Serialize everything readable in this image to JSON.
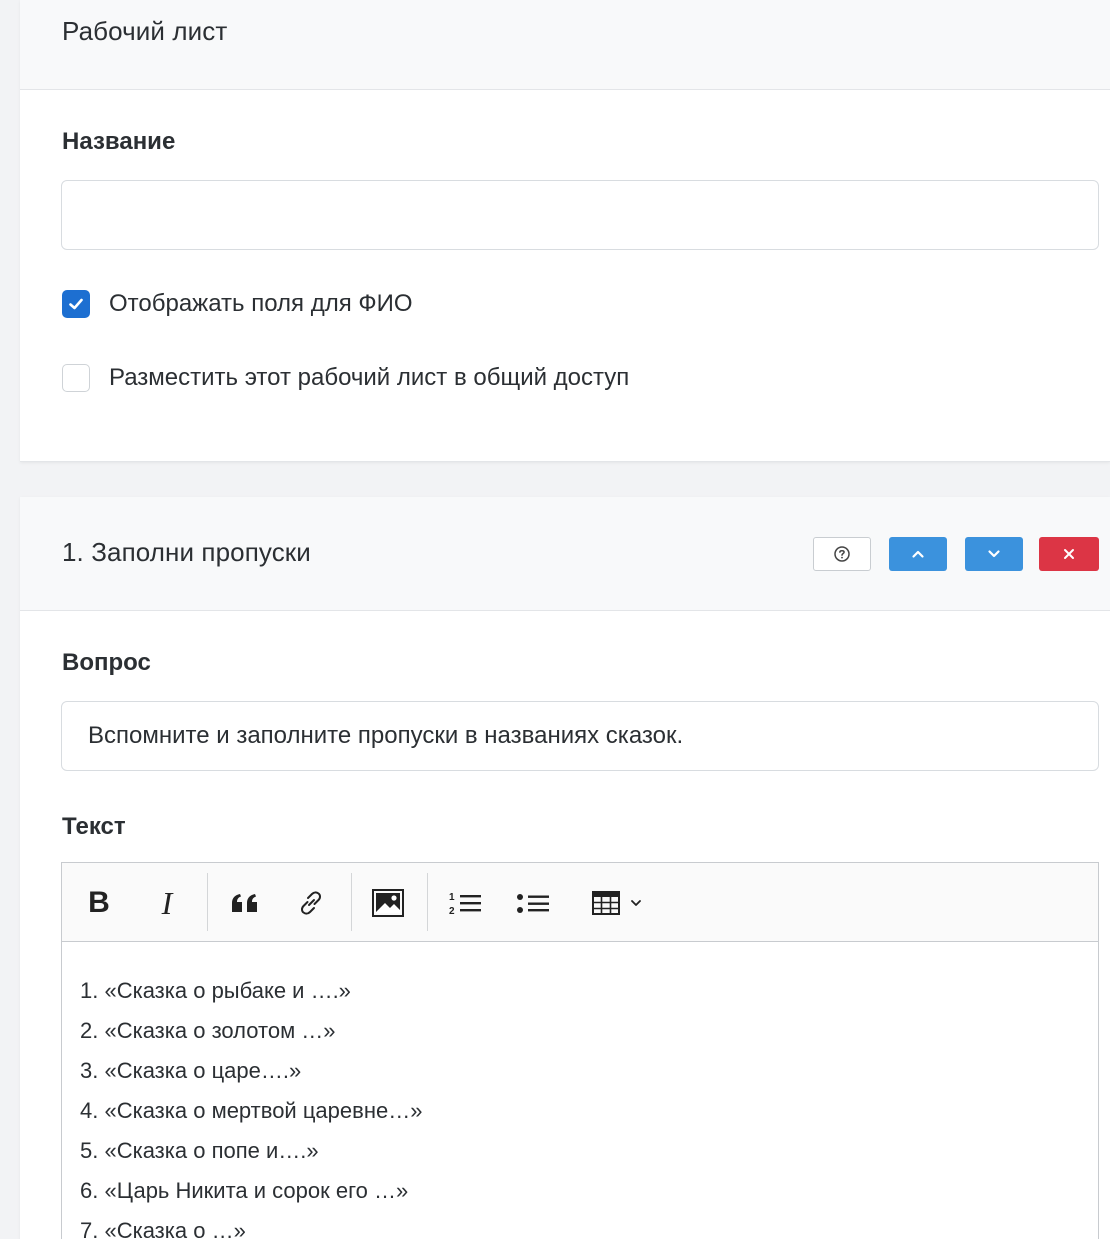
{
  "worksheet": {
    "title": "Рабочий лист",
    "name_label": "Название",
    "name_value": "",
    "show_fio": {
      "label": "Отображать поля для ФИО",
      "checked": true
    },
    "share": {
      "label": "Разместить этот рабочий лист в общий доступ",
      "checked": false
    }
  },
  "task": {
    "title": "1. Заполни пропуски",
    "buttons": {
      "help_icon": "question-circle-icon",
      "up_icon": "chevron-up-icon",
      "down_icon": "chevron-down-icon",
      "delete_icon": "close-icon"
    },
    "question_label": "Вопрос",
    "question_value": "Вспомните  и заполните пропуски в названиях сказок.",
    "text_label": "Текст",
    "toolbar": {
      "bold": "B",
      "italic": "I",
      "items": [
        "bold",
        "italic",
        "blockquote",
        "link",
        "image",
        "numbered-list",
        "bulleted-list",
        "table"
      ]
    },
    "text_lines": [
      "1. «Сказка о рыбаке и ….»",
      "2. «Сказка о золотом …»",
      "3. «Сказка о царе….»",
      "4. «Сказка о мертвой царевне…»",
      "5. «Сказка о попе и….»",
      "6. «Царь Никита и сорок его …»",
      "7. «Сказка о …»"
    ]
  },
  "colors": {
    "primary": "#1d6fd1",
    "info": "#3b92dd",
    "danger": "#dc3545",
    "header_bg": "#f8f9fa"
  }
}
